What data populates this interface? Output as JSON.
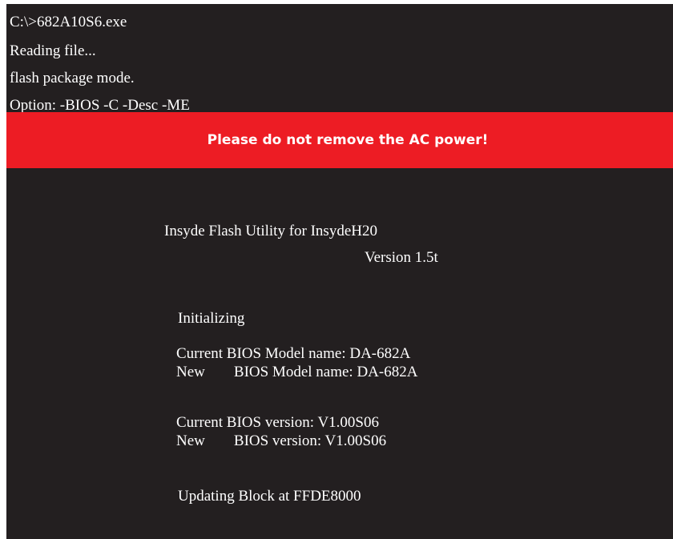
{
  "console": {
    "command": "C:\\>682A10S6.exe",
    "reading": "Reading file...",
    "mode": "flash package mode.",
    "options": "Option: -BIOS -C -Desc -ME"
  },
  "warning": {
    "text": "Please do not remove the AC power!",
    "color": "#ed1c24"
  },
  "utility": {
    "title": "Insyde Flash Utility for InsydeH20",
    "version": "Version 1.5t"
  },
  "status": {
    "initializing": "Initializing",
    "current_model_label": "Current BIOS Model name: DA-682A",
    "new_prefix": "New",
    "new_model_label": "BIOS Model name: DA-682A",
    "current_version_label": "Current BIOS version: V1.00S06",
    "new_version_label": "BIOS version: V1.00S06",
    "updating": "Updating Block at FFDE8000"
  }
}
